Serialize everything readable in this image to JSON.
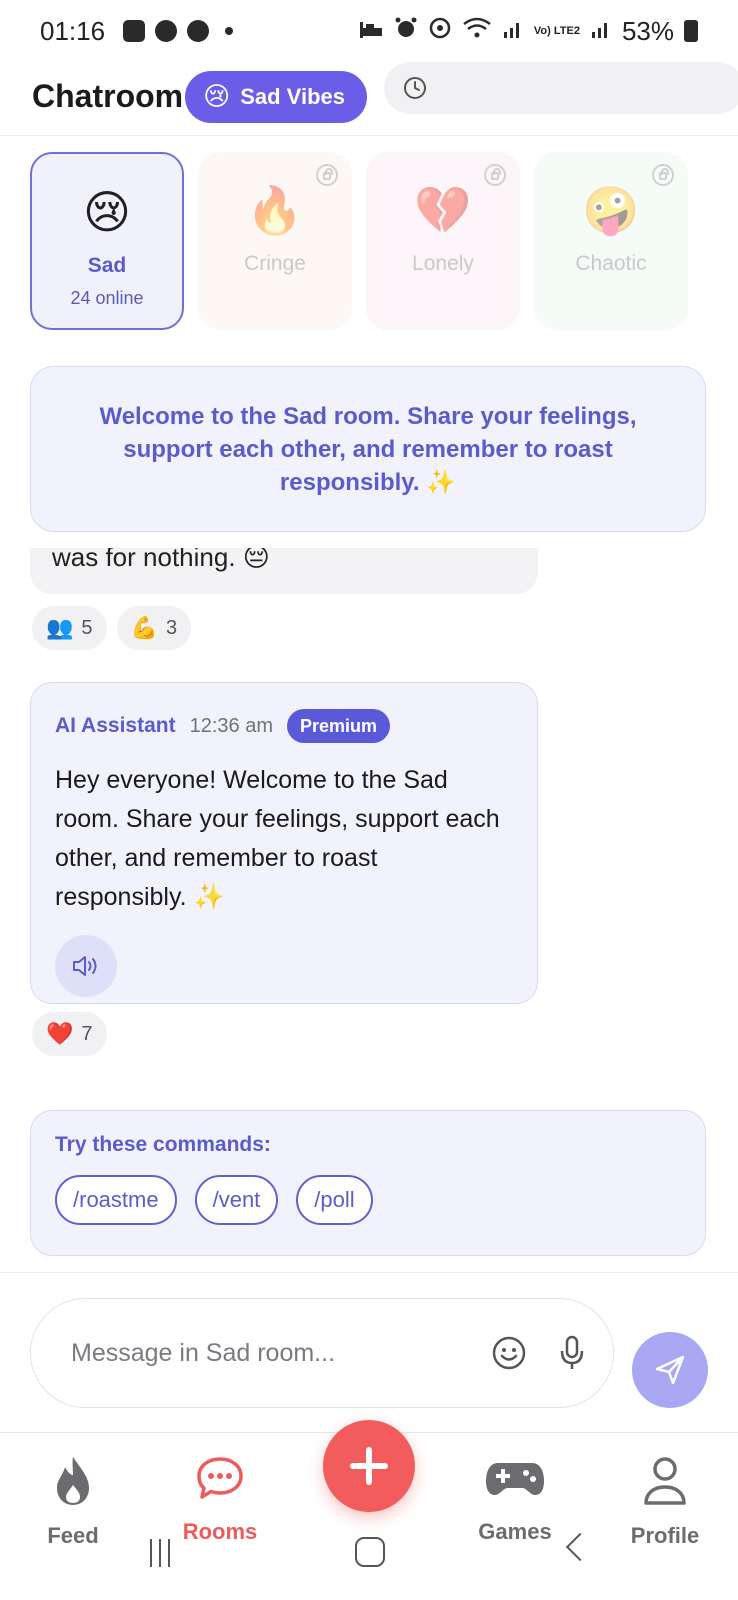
{
  "status": {
    "time": "01:16",
    "battery": "53%",
    "network": "Vo) LTE2"
  },
  "header": {
    "title": "Chatroom",
    "vibe_emoji": "😢",
    "vibe_label": "Sad Vibes"
  },
  "rooms": [
    {
      "emoji": "😢",
      "name": "Sad",
      "subtitle": "24 online",
      "locked": false
    },
    {
      "emoji": "🔥",
      "name": "Cringe",
      "locked": true
    },
    {
      "emoji": "💔",
      "name": "Lonely",
      "locked": true
    },
    {
      "emoji": "🤪",
      "name": "Chaotic",
      "locked": true
    }
  ],
  "welcome": {
    "text": "Welcome to the Sad room. Share your feelings, support each other, and remember to roast responsibly. ✨"
  },
  "previous_message": {
    "text": "was for nothing. 😔",
    "reactions": [
      {
        "emoji": "👥",
        "count": "5"
      },
      {
        "emoji": "💪",
        "count": "3"
      }
    ]
  },
  "ai_message": {
    "sender": "AI Assistant",
    "time": "12:36 am",
    "badge": "Premium",
    "text": "Hey everyone! Welcome to the Sad room. Share your feelings, support each other, and remember to roast responsibly. ✨",
    "reactions": [
      {
        "emoji": "❤️",
        "count": "7"
      }
    ]
  },
  "commands": {
    "title": "Try these commands:",
    "items": [
      "/roastme",
      "/vent",
      "/poll"
    ]
  },
  "input": {
    "placeholder": "Message in Sad room..."
  },
  "nav": {
    "feed": "Feed",
    "rooms": "Rooms",
    "games": "Games",
    "profile": "Profile"
  },
  "colors": {
    "accent": "#6a5de8",
    "active_nav": "#ef5b5b",
    "fab": "#f25c5c",
    "send": "#a8a7f2"
  }
}
